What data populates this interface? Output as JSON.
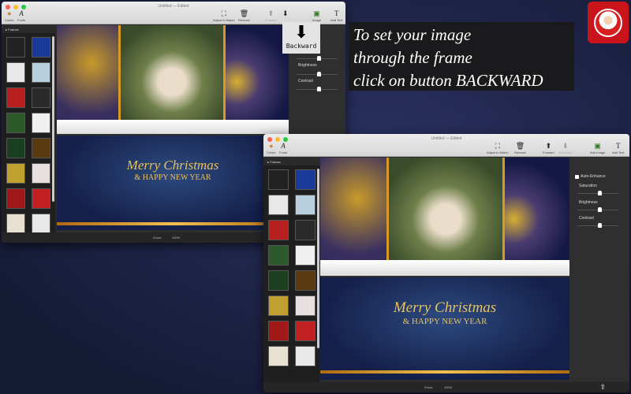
{
  "window_back": {
    "title": "Untitled — Edited",
    "toolbar": {
      "colors": "Colors",
      "fonts": "Fonts",
      "adjust": "Adjust to Match",
      "remove": "Remove",
      "forward": "Forward",
      "backward": "Backward",
      "add_image": "Image",
      "add_text": "Add Text"
    },
    "sidebar_header": "Frames",
    "right_panel": {
      "auto_enhance": "nhance",
      "brightness": "Brightness",
      "contrast": "Contrast"
    },
    "zoom_label": "Zoom:",
    "zoom_value": "100%",
    "card": {
      "line1": "Merry Christmas",
      "line2": "& HAPPY NEW YEAR"
    }
  },
  "window_front": {
    "title": "Untitled — Edited",
    "toolbar": {
      "colors": "Colors",
      "fonts": "Fonts",
      "adjust": "Adjust to Match",
      "remove": "Remove",
      "forward": "Forward",
      "backward": "Backward",
      "add_image": "Add Image",
      "add_text": "Add Text"
    },
    "sidebar_header": "Frames",
    "right_panel": {
      "auto_enhance": "Auto-Enhance",
      "saturation": "Saturation",
      "brightness": "Brightness",
      "contrast": "Contrast",
      "levels": {
        "saturation": 0.5,
        "brightness": 0.5,
        "contrast": 0.5
      }
    },
    "zoom_label": "Zoom:",
    "zoom_value": "100%",
    "card": {
      "line1": "Merry Christmas",
      "line2": "& HAPPY NEW YEAR"
    }
  },
  "tooltip": {
    "label": "Backward",
    "icon": "arrow-down-icon"
  },
  "caption": {
    "line1": "To set your image",
    "line2": "through the frame",
    "line3": "click on button BACKWARD"
  },
  "logo": {
    "icon": "santa-logo-icon",
    "color": "#c8141a"
  },
  "thumb_colors": [
    "#222",
    "#1a3a9a",
    "#e8e8e8",
    "#b8cfe0",
    "#b82020",
    "#2a2a2a",
    "#2d5a2a",
    "#f0f0f0",
    "#1a4020",
    "#5a3a10",
    "#c0a030",
    "#e8e0e0",
    "#a01818",
    "#c02020",
    "#e8e0d0",
    "#e8e8e8"
  ]
}
